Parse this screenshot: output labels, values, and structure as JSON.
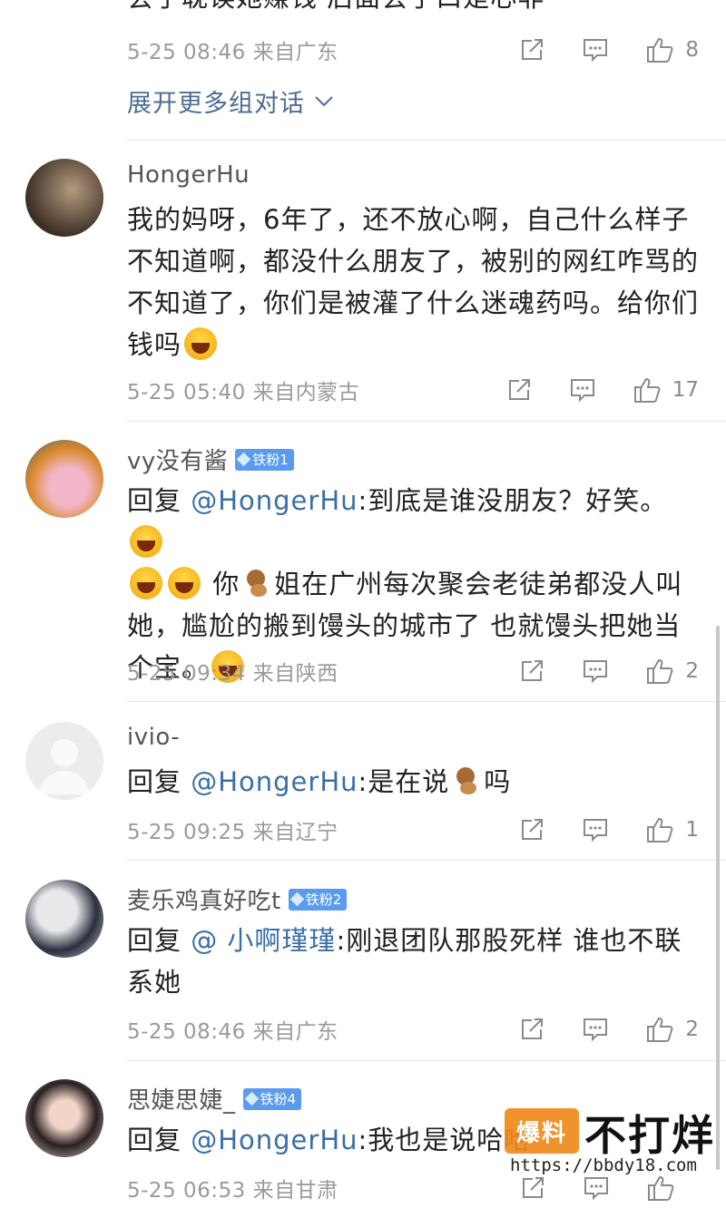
{
  "top": {
    "partial_text": "会了耽误她赚钱 后面会了口是心非",
    "meta": "5-25 08:46 来自广东",
    "likes": "8",
    "expand_label": "展开更多组对话"
  },
  "comments": [
    {
      "username": "HongerHu",
      "badge": "",
      "text_parts": [
        "我的妈呀，6年了，还不放心啊，自己什么样子不知道啊，都没什么朋友了，被别的网红咋骂的不知道了，你们是被灌了什么迷魂药吗。给你们钱吗"
      ],
      "meta": "5-25 05:40 来自内蒙古",
      "likes": "17"
    },
    {
      "username": "vy没有酱",
      "badge": "铁粉1",
      "reply_prefix": "回复 ",
      "mention": "@HongerHu",
      "text_a": ":到底是谁没朋友？好笑。",
      "text_b": "你",
      "text_c": "姐在广州每次聚会老徒弟都没人叫她，尴尬的搬到馒头的城市了 也就馒头把她当个宝。",
      "meta": "5-25 09:34 来自陕西",
      "likes": "2"
    },
    {
      "username": "ivio-",
      "badge": "",
      "reply_prefix": "回复 ",
      "mention": "@HongerHu",
      "text_a": ":是在说",
      "text_b": "吗",
      "meta": "5-25 09:25 来自辽宁",
      "likes": "1"
    },
    {
      "username": "麦乐鸡真好吃t",
      "badge": "铁粉2",
      "reply_prefix": "回复 ",
      "mention": "@ 小啊瑾瑾",
      "text_a": ":刚退团队那股死样 谁也不联系她",
      "meta": "5-25 08:46 来自广东",
      "likes": "2"
    },
    {
      "username": "思婕思婕_",
      "badge": "铁粉4",
      "reply_prefix": "回复 ",
      "mention": "@HongerHu",
      "text_a": ":我也是说哈哈",
      "meta": "5-25 06:53 来自甘肃",
      "likes": ""
    }
  ],
  "watermark": {
    "box": "爆料",
    "title": "不打烊",
    "url": "https://bbdy18.com"
  },
  "colors": {
    "accent_link": "#3a6ea8",
    "expand_link": "#4d6d94",
    "badge_bg": "#5a9bf0",
    "meta_gray": "#9a9a9a",
    "watermark_orange": "#f08a1c"
  },
  "icons": [
    "share-icon",
    "comment-icon",
    "like-icon",
    "chevron-down-icon",
    "diamond-icon"
  ]
}
